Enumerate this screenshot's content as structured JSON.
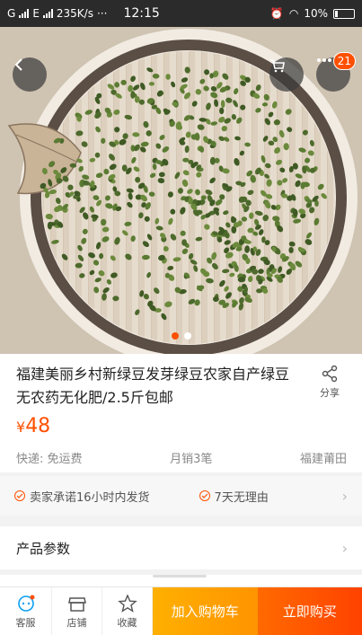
{
  "status_bar": {
    "carrier_left": "G",
    "carrier_right": "E",
    "speed": "235K/s",
    "dots": "···",
    "time": "12:15",
    "battery": "10%"
  },
  "nav": {
    "back_icon": "chevron-left-icon",
    "cart_icon": "cart-icon",
    "more_icon": "more-icon",
    "badge_count": "21"
  },
  "gallery": {
    "page_count": 2,
    "active_index": 0
  },
  "product": {
    "title": "福建美丽乡村新绿豆发芽绿豆农家自产绿豆无农药无化肥/2.5斤包邮",
    "currency": "¥",
    "price": "48",
    "share_label": "分享"
  },
  "meta": {
    "shipping": "快递: 免运费",
    "monthly_sales": "月销3笔",
    "location": "福建莆田"
  },
  "promises": {
    "item1": "卖家承诺16小时内发货",
    "item2": "7天无理由"
  },
  "params": {
    "label": "产品参数"
  },
  "bottom_bar": {
    "service": "客服",
    "shop": "店铺",
    "favorite": "收藏",
    "add_to_cart": "加入购物车",
    "buy_now": "立即购买"
  },
  "colors": {
    "accent": "#ff5000",
    "add_cart": "#ffa200",
    "buy_now": "#ff5000"
  }
}
